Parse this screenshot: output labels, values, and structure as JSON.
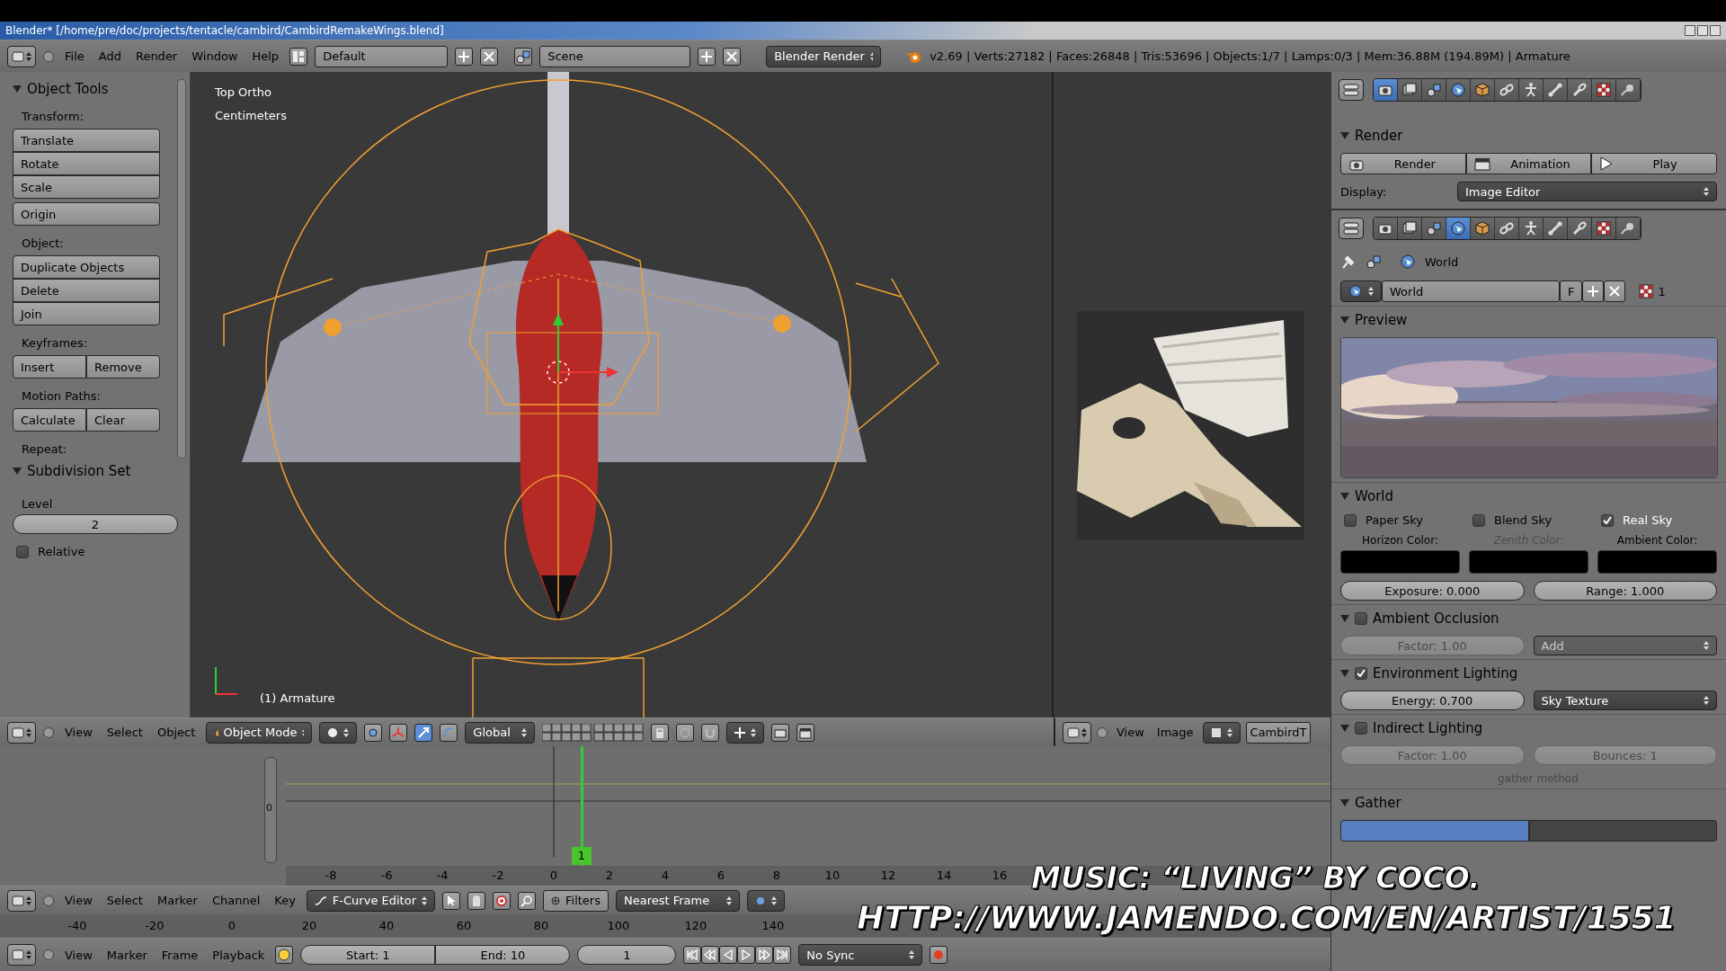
{
  "title_bar": {
    "title": "Blender* [/home/pre/doc/projects/tentacle/cambird/CambirdRemakeWings.blend]"
  },
  "info_header": {
    "menus": [
      "File",
      "Add",
      "Render",
      "Window",
      "Help"
    ],
    "layout": "Default",
    "scene": "Scene",
    "engine": "Blender Render",
    "stats": "v2.69 | Verts:27182 | Faces:26848 | Tris:53696 | Objects:1/7 | Lamps:0/3 | Mem:36.88M (194.89M) | Armature"
  },
  "tool_shelf": {
    "title": "Object Tools",
    "expanded": true,
    "groups": [
      {
        "kind": "label",
        "text": "Transform:"
      },
      {
        "kind": "stack",
        "buttons": [
          "Translate",
          "Rotate",
          "Scale"
        ]
      },
      {
        "kind": "stack",
        "buttons": [
          "Origin"
        ]
      },
      {
        "kind": "label",
        "text": "Object:"
      },
      {
        "kind": "stack",
        "buttons": [
          "Duplicate Objects",
          "Delete",
          "Join"
        ]
      },
      {
        "kind": "label",
        "text": "Keyframes:"
      },
      {
        "kind": "row",
        "buttons": [
          "Insert",
          "Remove"
        ]
      },
      {
        "kind": "label",
        "text": "Motion Paths:"
      },
      {
        "kind": "row",
        "buttons": [
          "Calculate",
          "Clear"
        ]
      },
      {
        "kind": "label",
        "text": "Repeat:"
      }
    ]
  },
  "operator_panel": {
    "title": "Subdivision Set",
    "expanded": true,
    "value_label": "Level",
    "value": "2",
    "relative": {
      "label": "Relative",
      "checked": false
    }
  },
  "viewport": {
    "view_name": "Top Ortho",
    "units": "Centimeters",
    "object_label": "(1) Armature"
  },
  "viewport_header": {
    "menus": [
      "View",
      "Select",
      "Object"
    ],
    "mode": "Object Mode",
    "orientation": "Global"
  },
  "image_editor_header": {
    "menus": [
      "View",
      "Image"
    ],
    "image_name": "CambirdT"
  },
  "graph_editor": {
    "channel_value": "0",
    "current_frame": "1",
    "ticks": [
      "-8",
      "-6",
      "-4",
      "-2",
      "0",
      "2",
      "4",
      "6",
      "8",
      "10",
      "12",
      "14",
      "16"
    ]
  },
  "graph_header": {
    "menus": [
      "View",
      "Select",
      "Marker",
      "Channel",
      "Key"
    ],
    "mode": "F-Curve Editor",
    "filters": "Filters",
    "snap": "Nearest Frame"
  },
  "timeline": {
    "ticks": [
      "-40",
      "-20",
      "0",
      "20",
      "40",
      "60",
      "80",
      "100",
      "120",
      "140"
    ]
  },
  "timeline_header": {
    "menus": [
      "View",
      "Marker",
      "Frame",
      "Playback"
    ],
    "start": "Start: 1",
    "end": "End: 10",
    "frame": "1",
    "sync": "No Sync"
  },
  "render_properties": {
    "tabs": [
      {
        "kind": "render",
        "selected": true
      },
      {
        "kind": "layers",
        "selected": false
      },
      {
        "kind": "scene",
        "selected": false
      },
      {
        "kind": "world",
        "selected": false
      },
      {
        "kind": "object",
        "selected": false
      },
      {
        "kind": "constraints",
        "selected": false
      },
      {
        "kind": "armature",
        "selected": false
      },
      {
        "kind": "bone",
        "selected": false
      },
      {
        "kind": "bone_constraints",
        "selected": false
      },
      {
        "kind": "texture",
        "selected": false
      },
      {
        "kind": "physics",
        "selected": false
      }
    ],
    "panel": {
      "title": "Render",
      "expanded": true,
      "buttons": [
        {
          "kind": "render",
          "label": "Render"
        },
        {
          "kind": "animation",
          "label": "Animation"
        },
        {
          "kind": "play",
          "label": "Play"
        }
      ],
      "display_label": "Display:",
      "display_value": "Image Editor"
    }
  },
  "world_properties": {
    "tabs": [
      {
        "kind": "render",
        "selected": false
      },
      {
        "kind": "layers",
        "selected": false
      },
      {
        "kind": "scene",
        "selected": false
      },
      {
        "kind": "world",
        "selected": true
      },
      {
        "kind": "object",
        "selected": false
      },
      {
        "kind": "constraints",
        "selected": false
      },
      {
        "kind": "armature",
        "selected": false
      },
      {
        "kind": "bone",
        "selected": false
      },
      {
        "kind": "bone_constraints",
        "selected": false
      },
      {
        "kind": "texture",
        "selected": false
      },
      {
        "kind": "physics",
        "selected": false
      }
    ],
    "breadcrumb": "World",
    "datablock": {
      "name": "World",
      "fake_user": "F",
      "users": "1"
    },
    "preview": {
      "title": "Preview",
      "expanded": true
    },
    "world": {
      "title": "World",
      "expanded": true,
      "sky_options": [
        {
          "label": "Paper Sky",
          "checked": false
        },
        {
          "label": "Blend Sky",
          "checked": false
        },
        {
          "label": "Real Sky",
          "checked": true
        }
      ],
      "colors": [
        {
          "label": "Horizon Color:",
          "disabled": false
        },
        {
          "label": "Zenith Color:",
          "disabled": true
        },
        {
          "label": "Ambient Color:",
          "disabled": false
        }
      ],
      "fields": [
        "Exposure: 0.000",
        "Range: 1.000"
      ]
    },
    "panels": [
      {
        "title": "Ambient Occlusion",
        "expanded": true,
        "enabled": false,
        "controls": [
          {
            "kind": "number",
            "text": "Factor: 1.00",
            "disabled": true
          },
          {
            "kind": "dropdown",
            "text": "Add",
            "disabled": true
          }
        ]
      },
      {
        "title": "Environment Lighting",
        "expanded": true,
        "enabled": true,
        "controls": [
          {
            "kind": "number",
            "text": "Energy: 0.700",
            "disabled": false
          },
          {
            "kind": "dropdown",
            "text": "Sky Texture",
            "disabled": false
          }
        ]
      },
      {
        "title": "Indirect Lighting",
        "expanded": true,
        "enabled": false,
        "controls": [
          {
            "kind": "number",
            "text": "Factor: 1.00",
            "disabled": true
          },
          {
            "kind": "number",
            "text": "Bounces: 1",
            "disabled": true
          }
        ],
        "note": "gather method"
      }
    ],
    "gather": {
      "title": "Gather",
      "expanded": true,
      "options": [
        {
          "selected": true
        },
        {
          "selected": false
        }
      ]
    }
  },
  "caption": {
    "lines": [
      "MUSIC: “LIVING” BY COCO.",
      "HTTP://WWW.JAMENDO.COM/EN/ARTIST/1551"
    ]
  }
}
